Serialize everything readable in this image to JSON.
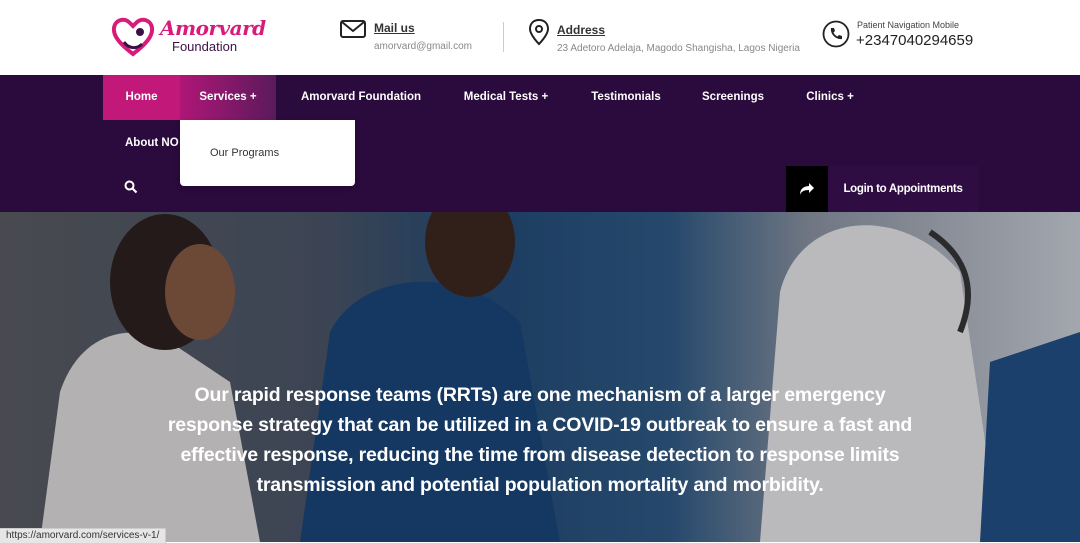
{
  "brand": {
    "name": "Amorvard",
    "subtitle": "Foundation"
  },
  "contact": {
    "mail_label": "Mail us",
    "mail_value": "amorvard@gmail.com",
    "address_label": "Address",
    "address_value": "23 Adetoro Adelaja, Magodo Shangisha, Lagos Nigeria",
    "phone_label": "Patient Navigation Mobile",
    "phone_value": "+2347040294659"
  },
  "nav": {
    "home": "Home",
    "services": "Services +",
    "foundation": "Amorvard Foundation",
    "medical_tests": "Medical Tests +",
    "testimonials": "Testimonials",
    "screenings": "Screenings",
    "clinics": "Clinics +",
    "about": "About NO"
  },
  "dropdown": {
    "item": "Our Programs"
  },
  "login": {
    "label": "Login to Appointments"
  },
  "hero": {
    "text": "Our rapid response teams (RRTs) are one mechanism of a larger emergency response strategy that can be utilized in a COVID-19 outbreak to ensure a fast and effective response, reducing the time from disease detection to response limits transmission and potential population mortality and morbidity."
  },
  "status_url": "https://amorvard.com/services-v-1/",
  "colors": {
    "accent": "#c2187a",
    "nav_bg": "#2b0a3d",
    "brand_pink": "#d81b7a"
  },
  "icons": [
    "heart-logo-icon",
    "mail-icon",
    "location-pin-icon",
    "phone-icon",
    "search-icon",
    "share-arrow-icon"
  ]
}
